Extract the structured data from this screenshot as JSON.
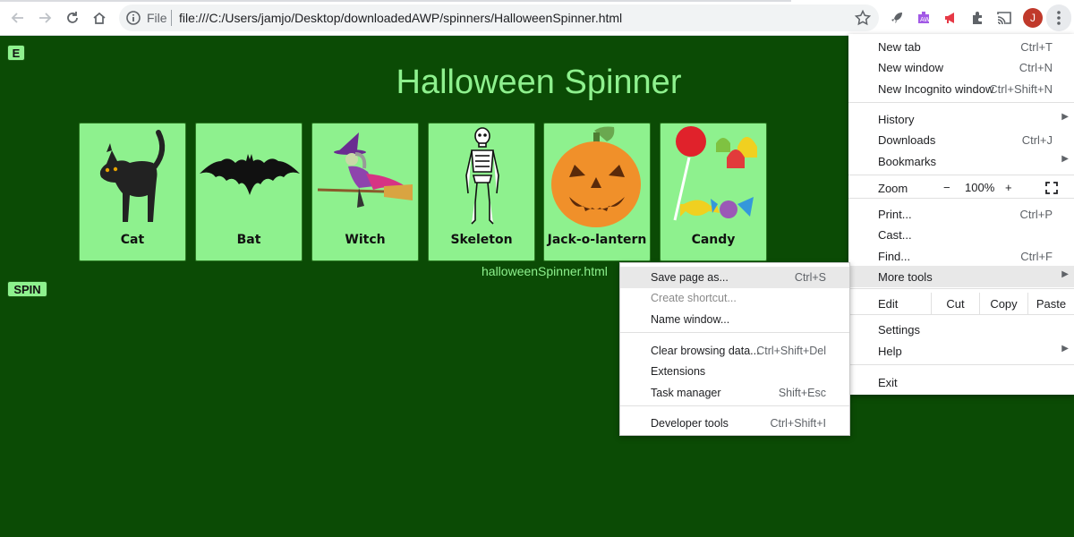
{
  "browser": {
    "file_label": "File",
    "url": "file:///C:/Users/jamjo/Desktop/downloadedAWP/spinners/HalloweenSpinner.html",
    "avatar_letter": "J"
  },
  "page": {
    "e_button": "E",
    "title": "Halloween Spinner",
    "cards": [
      {
        "label": "Cat"
      },
      {
        "label": "Bat"
      },
      {
        "label": "Witch"
      },
      {
        "label": "Skeleton"
      },
      {
        "label": "Jack-o-lantern"
      },
      {
        "label": "Candy"
      }
    ],
    "filename": "halloweenSpinner.html",
    "spin_button": "SPIN"
  },
  "menu": {
    "new_tab": {
      "label": "New tab",
      "shortcut": "Ctrl+T"
    },
    "new_window": {
      "label": "New window",
      "shortcut": "Ctrl+N"
    },
    "new_incognito": {
      "label": "New Incognito window",
      "shortcut": "Ctrl+Shift+N"
    },
    "history": {
      "label": "History"
    },
    "downloads": {
      "label": "Downloads",
      "shortcut": "Ctrl+J"
    },
    "bookmarks": {
      "label": "Bookmarks"
    },
    "zoom": {
      "label": "Zoom",
      "minus": "−",
      "value": "100%",
      "plus": "+"
    },
    "print": {
      "label": "Print...",
      "shortcut": "Ctrl+P"
    },
    "cast": {
      "label": "Cast..."
    },
    "find": {
      "label": "Find...",
      "shortcut": "Ctrl+F"
    },
    "more_tools": {
      "label": "More tools"
    },
    "edit": {
      "label": "Edit",
      "cut": "Cut",
      "copy": "Copy",
      "paste": "Paste"
    },
    "settings": {
      "label": "Settings"
    },
    "help": {
      "label": "Help"
    },
    "exit": {
      "label": "Exit"
    }
  },
  "submenu": {
    "save_page": {
      "label": "Save page as...",
      "shortcut": "Ctrl+S"
    },
    "create_shortcut": {
      "label": "Create shortcut..."
    },
    "name_window": {
      "label": "Name window..."
    },
    "clear_data": {
      "label": "Clear browsing data...",
      "shortcut": "Ctrl+Shift+Del"
    },
    "extensions": {
      "label": "Extensions"
    },
    "task_manager": {
      "label": "Task manager",
      "shortcut": "Shift+Esc"
    },
    "dev_tools": {
      "label": "Developer tools",
      "shortcut": "Ctrl+Shift+I"
    }
  },
  "colors": {
    "page_bg": "#0b4b05",
    "accent_green": "#8ef18e",
    "menu_highlight": "#e8e8e8"
  }
}
